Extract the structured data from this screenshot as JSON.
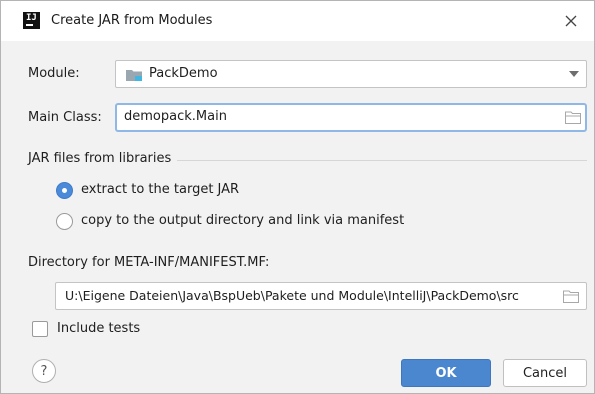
{
  "dialog": {
    "title": "Create JAR from Modules",
    "close_icon": "close-icon"
  },
  "module": {
    "label": "Module:",
    "value": "PackDemo",
    "icon": "module-folder-icon"
  },
  "main_class": {
    "label": "Main Class:",
    "value": "demopack.Main"
  },
  "libraries": {
    "group_title": "JAR files from libraries",
    "options": [
      {
        "label": "extract to the target JAR",
        "selected": true
      },
      {
        "label": "copy to the output directory and link via manifest",
        "selected": false
      }
    ]
  },
  "manifest": {
    "label": "Directory for META-INF/MANIFEST.MF:",
    "value": "U:\\Eigene Dateien\\Java\\BspUeb\\Pakete und Module\\IntelliJ\\PackDemo\\src"
  },
  "include_tests": {
    "label": "Include tests",
    "checked": false
  },
  "buttons": {
    "help": "?",
    "ok": "OK",
    "cancel": "Cancel"
  },
  "colors": {
    "accent": "#4a87cf",
    "focus_border": "#8fb8e6",
    "dialog_bg": "#f2f2f2"
  }
}
